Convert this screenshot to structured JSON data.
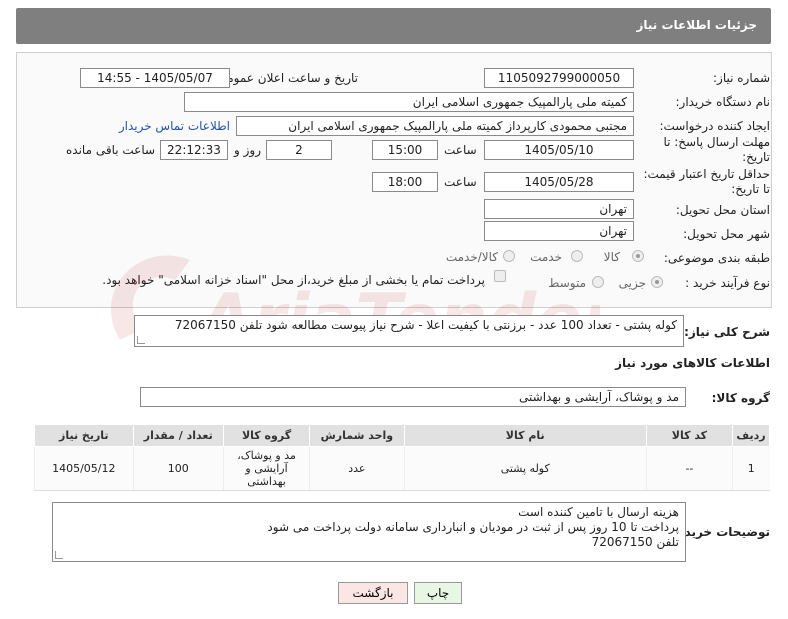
{
  "header": {
    "title": "جزئیات اطلاعات نیاز"
  },
  "form": {
    "need_number": {
      "label": "شماره نیاز:",
      "value": "1105092799000050"
    },
    "announce_datetime": {
      "label": "تاریخ و ساعت اعلان عمومی:",
      "value": "1405/05/07 - 14:55"
    },
    "buyer_org": {
      "label": "نام دستگاه خریدار:",
      "value": "کمیته ملی پارالمپیک جمهوری اسلامی ایران"
    },
    "requester": {
      "label": "ایجاد کننده درخواست:",
      "value": "مجتبی محمودی کارپرداز کمیته ملی پارالمپیک جمهوری اسلامی ایران",
      "contact_link": "اطلاعات تماس خریدار"
    },
    "deadline": {
      "label_line1": "مهلت ارسال پاسخ: تا",
      "label_line2": "تاریخ:",
      "date": "1405/05/10",
      "time_label": "ساعت",
      "time": "15:00",
      "days": "2",
      "days_label": "روز و",
      "remaining": "22:12:33",
      "remaining_label": "ساعت باقی مانده"
    },
    "price_validity": {
      "label_line1": "حداقل تاریخ اعتبار قیمت:",
      "label_line2": "تا تاریخ:",
      "date": "1405/05/28",
      "time_label": "ساعت",
      "time": "18:00"
    },
    "province": {
      "label": "استان محل تحویل:",
      "value": "تهران"
    },
    "city": {
      "label": "شهر محل تحویل:",
      "value": "تهران"
    },
    "category": {
      "label": "طبقه بندی موضوعی:",
      "options": [
        "کالا",
        "خدمت",
        "کالا/خدمت"
      ],
      "selected": "کالا"
    },
    "process": {
      "label": "نوع فرآیند خرید :",
      "options": [
        "جزیی",
        "متوسط"
      ],
      "selected": "جزیی",
      "payment_note": "پرداخت تمام یا بخشی از مبلغ خرید،از محل \"اسناد خزانه اسلامی\" خواهد بود."
    }
  },
  "summary": {
    "label": "شرح کلی نیاز:",
    "value": "کوله پشتی - تعداد 100 عدد - برزنتی با کیفیت اعلا - شرح نیاز پیوست مطالعه شود تلفن 72067150"
  },
  "goods_info_title": "اطلاعات کالاهای مورد نیاز",
  "goods_group": {
    "label": "گروه کالا:",
    "value": "مد و پوشاک، آرایشی و بهداشتی"
  },
  "table": {
    "headers": [
      "ردیف",
      "کد کالا",
      "نام کالا",
      "واحد شمارش",
      "گروه کالا",
      "تعداد / مقدار",
      "تاریخ نیاز"
    ],
    "rows": [
      {
        "row": "1",
        "code": "--",
        "name": "کوله پشتی",
        "unit": "عدد",
        "group": "مد و پوشاک، آرایشی و بهداشتی",
        "qty": "100",
        "date": "1405/05/12"
      }
    ]
  },
  "buyer_notes": {
    "label": "توضیحات خریدار:",
    "lines": [
      "هزینه ارسال با تامین کننده است",
      "پرداخت تا 10 روز پس از ثبت در مودیان و انبارداری سامانه دولت پرداخت می شود",
      "تلفن 72067150"
    ]
  },
  "buttons": {
    "print": "چاپ",
    "back": "بازگشت"
  },
  "watermark": "AriaTender.net",
  "colors": {
    "header_bg": "#7f7f7f",
    "print_btn": "#e8f7e4",
    "back_btn": "#fbe6e6",
    "link": "#2255aa"
  }
}
